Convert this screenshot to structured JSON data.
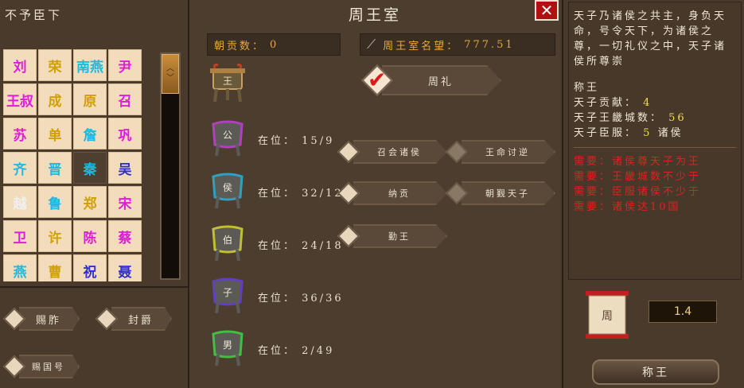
{
  "left": {
    "title": "不予臣下",
    "states": [
      {
        "name": "刘",
        "color": "#e01cdc"
      },
      {
        "name": "荣",
        "color": "#d0a000"
      },
      {
        "name": "南燕",
        "color": "#20b8e0"
      },
      {
        "name": "尹",
        "color": "#e01cdc"
      },
      {
        "name": "王叔",
        "color": "#e01cdc"
      },
      {
        "name": "成",
        "color": "#d0a000"
      },
      {
        "name": "原",
        "color": "#d0a000"
      },
      {
        "name": "召",
        "color": "#e01cdc"
      },
      {
        "name": "苏",
        "color": "#e01cdc"
      },
      {
        "name": "单",
        "color": "#d0a000"
      },
      {
        "name": "詹",
        "color": "#20b8e0"
      },
      {
        "name": "巩",
        "color": "#e01cdc"
      },
      {
        "name": "齐",
        "color": "#20b8e0"
      },
      {
        "name": "晋",
        "color": "#20b8e0"
      },
      {
        "name": "秦",
        "color": "#20b8e0"
      },
      {
        "name": "吴",
        "color": "#3030d0"
      },
      {
        "name": "越",
        "color": "#f0f0f0"
      },
      {
        "name": "鲁",
        "color": "#20b8e0"
      },
      {
        "name": "郑",
        "color": "#d0a000"
      },
      {
        "name": "宋",
        "color": "#e01cdc"
      },
      {
        "name": "卫",
        "color": "#e01cdc"
      },
      {
        "name": "许",
        "color": "#d0a000"
      },
      {
        "name": "陈",
        "color": "#e01cdc"
      },
      {
        "name": "蔡",
        "color": "#e01cdc"
      },
      {
        "name": "燕",
        "color": "#20b8e0"
      },
      {
        "name": "曹",
        "color": "#d0a000"
      },
      {
        "name": "祝",
        "color": "#3030d0"
      },
      {
        "name": "聂",
        "color": "#3030d0"
      }
    ],
    "buttons": {
      "b1": "赐胙",
      "b2": "封爵",
      "b3": "赐国号"
    }
  },
  "center": {
    "title": "周王室",
    "tribute_label": "朝贡数：",
    "tribute_value": "0",
    "prestige_label": "周王室名望：",
    "prestige_value": "777.51",
    "btn_main": "周礼",
    "btn_a": "召会诸侯",
    "btn_b": "王命讨逆",
    "btn_c": "纳贡",
    "btn_d": "勤王",
    "btn_e": "朝觐天子",
    "vessel_top": "王",
    "vessels": [
      {
        "glyph": "公",
        "label": "在位：",
        "value": "15/9"
      },
      {
        "glyph": "侯",
        "label": "在位：",
        "value": "32/12"
      },
      {
        "glyph": "伯",
        "label": "在位：",
        "value": "24/18"
      },
      {
        "glyph": "子",
        "label": "在位：",
        "value": "36/36"
      },
      {
        "glyph": "男",
        "label": "在位：",
        "value": "2/49"
      }
    ]
  },
  "right": {
    "desc": "天子乃诸侯之共主，身负天命，号令天下，为诸侯之尊，一切礼仪之中，天子诸侯所尊崇",
    "rank_label": "称王",
    "stat1_label": "天子贡献：",
    "stat1_value": "4",
    "stat2_label": "天子王畿城数：",
    "stat2_value": "56",
    "stat3_label": "天子臣服：",
    "stat3_value": "5",
    "stat3_unit": "诸侯",
    "reqs": [
      "需要：诸侯尊天子为王",
      "需要：王畿城数不少于",
      "需要：臣服诸侯不少于",
      "需要：诸侯达10国"
    ],
    "scroll_glyph": "周",
    "ratio": "1.4",
    "confirm": "称王"
  },
  "colors": {
    "close": "#b01010",
    "accent": "#e8a83a",
    "red_text": "#e02020",
    "yellow_text": "#f0e040"
  }
}
